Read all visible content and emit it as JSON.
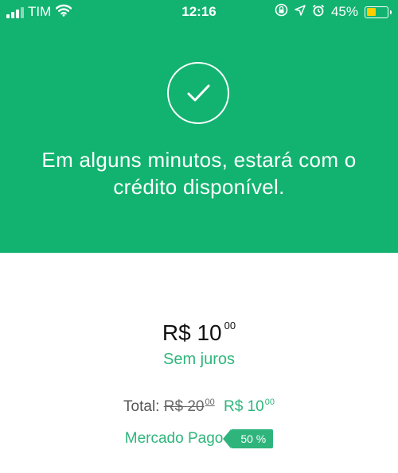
{
  "status_bar": {
    "carrier": "TIM",
    "time": "12:16",
    "battery_percent": "45%",
    "battery_level": 0.45,
    "icons": [
      "signal-icon",
      "wifi-icon",
      "rotation-lock-icon",
      "location-icon",
      "alarm-icon",
      "battery-icon"
    ],
    "battery_color": "#ffcc00"
  },
  "header": {
    "background_color": "#12b370",
    "icon": "check-circle-icon",
    "message": "Em alguns minutos, estará com o crédito disponível."
  },
  "summary": {
    "currency": "R$",
    "amount": "10",
    "amount_cents": "00",
    "interest_label": "Sem juros",
    "total_label": "Total:",
    "old_amount": "20",
    "old_cents": "00",
    "new_amount": "10",
    "new_cents": "00",
    "provider": "Mercado Pago",
    "discount": "50 %",
    "accent_color": "#2fb57c"
  }
}
